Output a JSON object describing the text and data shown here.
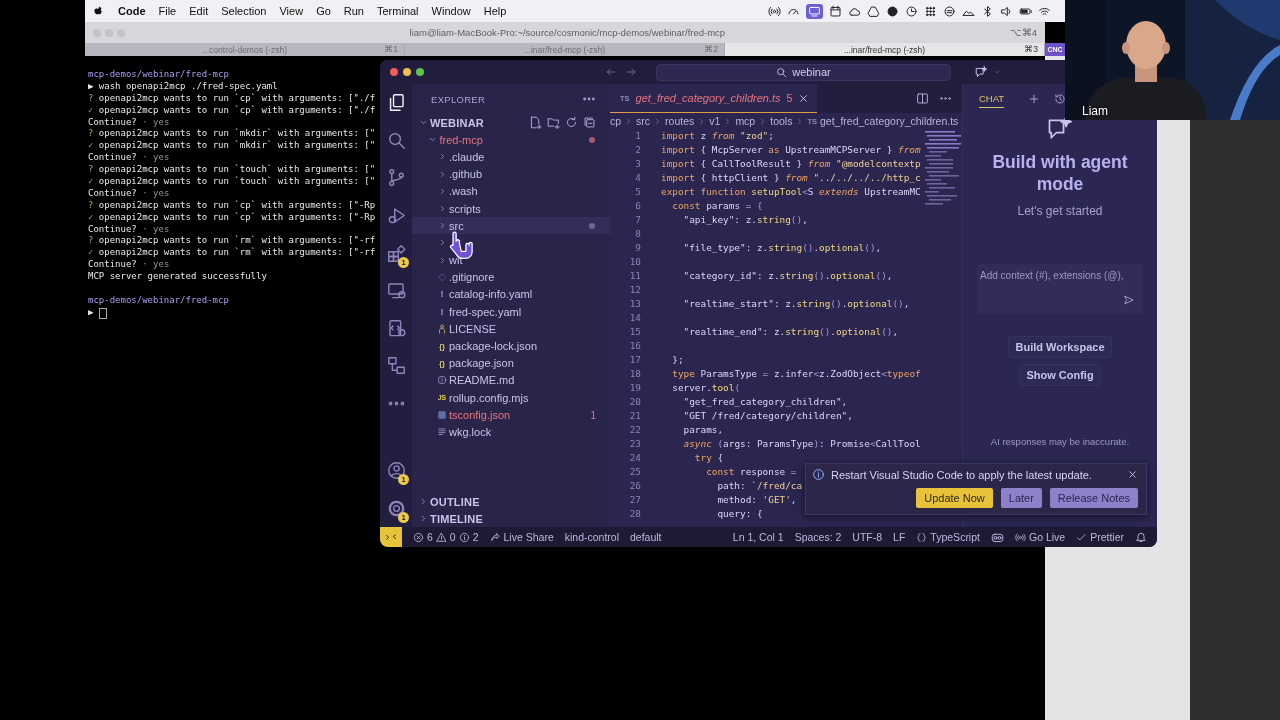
{
  "menu_bar": {
    "app_name": "Code",
    "items": [
      "File",
      "Edit",
      "Selection",
      "View",
      "Go",
      "Run",
      "Terminal",
      "Window",
      "Help"
    ]
  },
  "terminal": {
    "title": "liam@liam-MacBook-Pro:~/source/cosmonic/mcp-demos/webinar/fred-mcp",
    "shortcut": "⌥⌘4",
    "tabs": [
      {
        "label": "...control-demos (-zsh)",
        "shortcut": "⌘1",
        "selected": false
      },
      {
        "label": "...inar/fred-mcp (-zsh)",
        "shortcut": "⌘2",
        "selected": false
      },
      {
        "label": "...inar/fred-mcp (-zsh)",
        "shortcut": "⌘3",
        "selected": true
      }
    ],
    "side_tab": "CNC",
    "lines": [
      {
        "kind": "path",
        "text": "mcp-demos/webinar/fred-mcp"
      },
      {
        "kind": "command",
        "mark": "▶",
        "text": "wash openapi2mcp ./fred-spec.yaml"
      },
      {
        "kind": "ask",
        "mark": "?",
        "text": "openapi2mcp wants to run `cp` with arguments: [\"./f"
      },
      {
        "kind": "done",
        "mark": "✓",
        "text": "openapi2mcp wants to run `cp` with arguments: [\"./f"
      },
      {
        "kind": "confirm",
        "text": "Continue?",
        "answer": "· yes"
      },
      {
        "kind": "ask",
        "mark": "?",
        "text": "openapi2mcp wants to run `mkdir` with arguments: [\""
      },
      {
        "kind": "done",
        "mark": "✓",
        "text": "openapi2mcp wants to run `mkdir` with arguments: [\""
      },
      {
        "kind": "confirm",
        "text": "Continue?",
        "answer": "· yes"
      },
      {
        "kind": "ask",
        "mark": "?",
        "text": "openapi2mcp wants to run `touch` with arguments: [\""
      },
      {
        "kind": "done",
        "mark": "✓",
        "text": "openapi2mcp wants to run `touch` with arguments: [\""
      },
      {
        "kind": "confirm",
        "text": "Continue?",
        "answer": "· yes"
      },
      {
        "kind": "ask",
        "mark": "?",
        "text": "openapi2mcp wants to run `cp` with arguments: [\"-Rp"
      },
      {
        "kind": "done",
        "mark": "✓",
        "text": "openapi2mcp wants to run `cp` with arguments: [\"-Rp"
      },
      {
        "kind": "confirm",
        "text": "Continue?",
        "answer": "· yes"
      },
      {
        "kind": "ask",
        "mark": "?",
        "text": "openapi2mcp wants to run `rm` with arguments: [\"-rf"
      },
      {
        "kind": "done",
        "mark": "✓",
        "text": "openapi2mcp wants to run `rm` with arguments: [\"-rf"
      },
      {
        "kind": "confirm",
        "text": "Continue?",
        "answer": "· yes"
      },
      {
        "kind": "plain",
        "text": "MCP server generated successfully"
      },
      {
        "kind": "blank"
      },
      {
        "kind": "path",
        "text": "mcp-demos/webinar/fred-mcp"
      },
      {
        "kind": "input",
        "mark": "▶"
      }
    ]
  },
  "vscode": {
    "title_bar": {
      "search": "webinar"
    },
    "activity_bar": {
      "items": [
        {
          "kind": "explorer",
          "selected": true
        },
        {
          "kind": "search",
          "selected": false
        },
        {
          "kind": "source-control",
          "selected": false
        },
        {
          "kind": "run-debug",
          "selected": false
        },
        {
          "kind": "extensions",
          "selected": false,
          "badge": "1"
        },
        {
          "kind": "remote",
          "selected": false
        },
        {
          "kind": "container",
          "selected": false
        },
        {
          "kind": "diagram",
          "selected": false
        },
        {
          "kind": "more",
          "selected": false
        }
      ],
      "bottom": [
        {
          "kind": "account",
          "badge": "1"
        },
        {
          "kind": "gear",
          "badge": "1"
        }
      ]
    },
    "explorer": {
      "title": "EXPLORER",
      "workspace": {
        "label": "WEBINAR",
        "expanded": true,
        "children": [
          {
            "kind": "folder",
            "label": "fred-mcp",
            "expanded": true,
            "error": true,
            "dot": true,
            "hovered": false,
            "children": [
              {
                "kind": "folder",
                "label": ".claude",
                "expanded": false,
                "error": false,
                "dot": false,
                "hovered": false
              },
              {
                "kind": "folder",
                "label": ".github",
                "expanded": false,
                "error": false,
                "dot": false,
                "hovered": false
              },
              {
                "kind": "folder",
                "label": ".wash",
                "expanded": false,
                "error": false,
                "dot": false,
                "hovered": false
              },
              {
                "kind": "folder",
                "label": "scripts",
                "expanded": false,
                "error": false,
                "dot": false,
                "hovered": false
              },
              {
                "kind": "folder",
                "label": "src",
                "expanded": false,
                "error": false,
                "dot": true,
                "hovered": true
              },
              {
                "kind": "folder",
                "expanded": false,
                "dot": false,
                "hovered": false
              },
              {
                "kind": "folder",
                "label": "wit",
                "expanded": false,
                "error": false,
                "dot": false,
                "hovered": false
              },
              {
                "kind": "git",
                "label": ".gitignore",
                "error": false,
                "dot": false,
                "hovered": false
              },
              {
                "kind": "yaml",
                "glyph": "!",
                "label": "catalog-info.yaml",
                "error": false,
                "dot": false,
                "hovered": false
              },
              {
                "kind": "yaml",
                "glyph": "!",
                "label": "fred-spec.yaml",
                "error": false,
                "dot": false,
                "hovered": false
              },
              {
                "kind": "license",
                "label": "LICENSE",
                "error": false,
                "dot": false,
                "hovered": false
              },
              {
                "kind": "json",
                "glyph": "{}",
                "label": "package-lock.json",
                "error": false,
                "dot": false,
                "hovered": false
              },
              {
                "kind": "json",
                "glyph": "{}",
                "label": "package.json",
                "error": false,
                "dot": false,
                "hovered": false
              },
              {
                "kind": "info",
                "label": "README.md",
                "error": false,
                "dot": false,
                "hovered": false
              },
              {
                "kind": "js",
                "glyph": "JS",
                "label": "rollup.config.mjs",
                "error": false,
                "dot": false,
                "hovered": false
              },
              {
                "kind": "config",
                "label": "tsconfig.json",
                "error": true,
                "dot": false,
                "hovered": false,
                "badge": "1"
              },
              {
                "kind": "lock",
                "label": "wkg.lock",
                "error": false,
                "dot": false,
                "hovered": false
              }
            ]
          }
        ]
      },
      "sections": [
        {
          "label": "OUTLINE",
          "expanded": false
        },
        {
          "label": "TIMELINE",
          "expanded": false
        }
      ]
    },
    "editor": {
      "tabs": [
        {
          "glyph": "TS",
          "label": "get_fred_category_children.ts",
          "problems": "5",
          "selected": true,
          "error": true
        }
      ],
      "breadcrumbs": [
        {
          "label": "cp"
        },
        {
          "label": "src"
        },
        {
          "label": "routes"
        },
        {
          "label": "v1"
        },
        {
          "label": "mcp"
        },
        {
          "label": "tools"
        },
        {
          "glyph": "TS",
          "label": "get_fred_category_children.ts"
        }
      ],
      "lines": [
        {
          "n": "1",
          "tokens": [
            {
              "kind": "keyword",
              "text": "import"
            },
            {
              "kind": "plain",
              "text": " z "
            },
            {
              "kind": "keyword-italic",
              "text": "from"
            },
            {
              "kind": "string",
              "text": " \"zod\""
            },
            {
              "kind": "plain",
              "text": ";"
            }
          ]
        },
        {
          "n": "2",
          "tokens": [
            {
              "kind": "keyword",
              "text": "import"
            },
            {
              "kind": "plain",
              "text": " { McpServer "
            },
            {
              "kind": "keyword",
              "text": "as"
            },
            {
              "kind": "plain",
              "text": " UpstreamMCPServer } "
            },
            {
              "kind": "keyword-italic",
              "text": "from"
            }
          ]
        },
        {
          "n": "3",
          "tokens": [
            {
              "kind": "keyword",
              "text": "import"
            },
            {
              "kind": "plain",
              "text": " { CallToolResult } "
            },
            {
              "kind": "keyword-italic",
              "text": "from"
            },
            {
              "kind": "string",
              "text": " \"@modelcontextp"
            }
          ]
        },
        {
          "n": "4",
          "tokens": [
            {
              "kind": "keyword",
              "text": "import"
            },
            {
              "kind": "plain",
              "text": " { httpClient } "
            },
            {
              "kind": "keyword-italic",
              "text": "from"
            },
            {
              "kind": "string",
              "text": " \"../../../../http_c"
            }
          ]
        },
        {
          "n": "5",
          "tokens": [
            {
              "kind": "keyword",
              "text": "export"
            },
            {
              "kind": "keyword",
              "text": " function"
            },
            {
              "kind": "function",
              "text": " setupTool"
            },
            {
              "kind": "punct",
              "text": "<"
            },
            {
              "kind": "plain",
              "text": "S "
            },
            {
              "kind": "keyword-italic",
              "text": "extends"
            },
            {
              "kind": "plain",
              "text": " UpstreamMC"
            }
          ]
        },
        {
          "n": "6",
          "tokens": [
            {
              "kind": "keyword",
              "text": "  const"
            },
            {
              "kind": "plain",
              "text": " params "
            },
            {
              "kind": "punct",
              "text": "="
            },
            {
              "kind": "punct",
              "text": " {"
            }
          ]
        },
        {
          "n": "7",
          "tokens": [
            {
              "kind": "plain",
              "text": "    \"api_key\": z."
            },
            {
              "kind": "function",
              "text": "string"
            },
            {
              "kind": "punct",
              "text": "()"
            },
            {
              "kind": "plain",
              "text": ","
            }
          ]
        },
        {
          "n": "8"
        },
        {
          "n": "9",
          "tokens": [
            {
              "kind": "plain",
              "text": "    \"file_type\": z."
            },
            {
              "kind": "function",
              "text": "string"
            },
            {
              "kind": "punct",
              "text": "()"
            },
            {
              "kind": "plain",
              "text": "."
            },
            {
              "kind": "function",
              "text": "optional"
            },
            {
              "kind": "punct",
              "text": "()"
            },
            {
              "kind": "plain",
              "text": ","
            }
          ]
        },
        {
          "n": "10"
        },
        {
          "n": "11",
          "tokens": [
            {
              "kind": "plain",
              "text": "    \"category_id\": z."
            },
            {
              "kind": "function",
              "text": "string"
            },
            {
              "kind": "punct",
              "text": "()"
            },
            {
              "kind": "plain",
              "text": "."
            },
            {
              "kind": "function",
              "text": "optional"
            },
            {
              "kind": "punct",
              "text": "()"
            },
            {
              "kind": "plain",
              "text": ","
            }
          ]
        },
        {
          "n": "12"
        },
        {
          "n": "13",
          "tokens": [
            {
              "kind": "plain",
              "text": "    \"realtime_start\": z."
            },
            {
              "kind": "function",
              "text": "string"
            },
            {
              "kind": "punct",
              "text": "()"
            },
            {
              "kind": "plain",
              "text": "."
            },
            {
              "kind": "function",
              "text": "optional"
            },
            {
              "kind": "punct",
              "text": "()"
            },
            {
              "kind": "plain",
              "text": ","
            }
          ]
        },
        {
          "n": "14"
        },
        {
          "n": "15",
          "tokens": [
            {
              "kind": "plain",
              "text": "    \"realtime_end\": z."
            },
            {
              "kind": "function",
              "text": "string"
            },
            {
              "kind": "punct",
              "text": "()"
            },
            {
              "kind": "plain",
              "text": "."
            },
            {
              "kind": "function",
              "text": "optional"
            },
            {
              "kind": "punct",
              "text": "()"
            },
            {
              "kind": "plain",
              "text": ","
            }
          ]
        },
        {
          "n": "16"
        },
        {
          "n": "17",
          "tokens": [
            {
              "kind": "plain",
              "text": "  };"
            }
          ]
        },
        {
          "n": "18",
          "tokens": [
            {
              "kind": "keyword",
              "text": "  type"
            },
            {
              "kind": "plain",
              "text": " ParamsType "
            },
            {
              "kind": "punct",
              "text": "="
            },
            {
              "kind": "plain",
              "text": " z.infer"
            },
            {
              "kind": "punct",
              "text": "<"
            },
            {
              "kind": "plain",
              "text": "z.ZodObject"
            },
            {
              "kind": "punct",
              "text": "<"
            },
            {
              "kind": "keyword",
              "text": "typeof"
            }
          ]
        },
        {
          "n": "19",
          "tokens": [
            {
              "kind": "plain",
              "text": "  server."
            },
            {
              "kind": "function",
              "text": "tool"
            },
            {
              "kind": "punct",
              "text": "("
            }
          ]
        },
        {
          "n": "20",
          "tokens": [
            {
              "kind": "plain",
              "text": "    \"get_fred_category_children\","
            }
          ]
        },
        {
          "n": "21",
          "tokens": [
            {
              "kind": "plain",
              "text": "    \"GET /fred/category/children\","
            }
          ]
        },
        {
          "n": "22",
          "tokens": [
            {
              "kind": "plain",
              "text": "    params,"
            }
          ]
        },
        {
          "n": "23",
          "tokens": [
            {
              "kind": "keyword-italic",
              "text": "    async"
            },
            {
              "kind": "punct",
              "text": " ("
            },
            {
              "kind": "plain",
              "text": "args: ParamsType"
            },
            {
              "kind": "punct",
              "text": ")"
            },
            {
              "kind": "plain",
              "text": ": Promise"
            },
            {
              "kind": "punct",
              "text": "<"
            },
            {
              "kind": "plain",
              "text": "CallTool"
            }
          ]
        },
        {
          "n": "24",
          "tokens": [
            {
              "kind": "keyword",
              "text": "      try"
            },
            {
              "kind": "plain",
              "text": " {"
            }
          ]
        },
        {
          "n": "25",
          "tokens": [
            {
              "kind": "keyword",
              "text": "        const"
            },
            {
              "kind": "plain",
              "text": " response "
            },
            {
              "kind": "punct",
              "text": "="
            }
          ]
        },
        {
          "n": "26",
          "tokens": [
            {
              "kind": "plain",
              "text": "          path: "
            },
            {
              "kind": "string",
              "text": "`/fred/ca"
            }
          ]
        },
        {
          "n": "27",
          "tokens": [
            {
              "kind": "plain",
              "text": "          method: "
            },
            {
              "kind": "string",
              "text": "'GET'"
            },
            {
              "kind": "plain",
              "text": ","
            }
          ]
        },
        {
          "n": "28",
          "tokens": [
            {
              "kind": "plain",
              "text": "          query: {"
            }
          ]
        }
      ]
    },
    "chat": {
      "tabs": [
        {
          "label": "CHAT",
          "selected": true
        }
      ],
      "title": "Build with agent mode",
      "subtitle": "Let's get started",
      "input_placeholder": "Add context (#), extensions (@),",
      "actions": [
        "Build Workspace",
        "Show Config"
      ],
      "disclaimer": "AI responses may be inaccurate."
    },
    "notification": {
      "message": "Restart Visual Studio Code to apply the latest update.",
      "buttons": [
        {
          "label": "Update Now",
          "primary": true
        },
        {
          "label": "Later",
          "primary": false
        },
        {
          "label": "Release Notes",
          "primary": false
        }
      ]
    },
    "status_bar": {
      "left": [
        {
          "kind": "remote"
        },
        {
          "kind": "problems",
          "errors": "6",
          "warnings": "0",
          "infos": "2"
        },
        {
          "kind": "liveshare",
          "text": "Live Share"
        },
        {
          "kind": "text",
          "text": "kind-control"
        },
        {
          "kind": "text",
          "text": "default"
        }
      ],
      "right": [
        {
          "kind": "text",
          "text": "Ln 1, Col 1"
        },
        {
          "kind": "text",
          "text": "Spaces: 2"
        },
        {
          "kind": "text",
          "text": "UTF-8"
        },
        {
          "kind": "text",
          "text": "LF"
        },
        {
          "kind": "language",
          "text": "TypeScript"
        },
        {
          "kind": "copilot"
        },
        {
          "kind": "golive",
          "text": "Go Live"
        },
        {
          "kind": "prettier",
          "text": "Prettier"
        },
        {
          "kind": "bell"
        }
      ]
    }
  },
  "webcam": {
    "kind": "picture",
    "name": "Liam"
  }
}
